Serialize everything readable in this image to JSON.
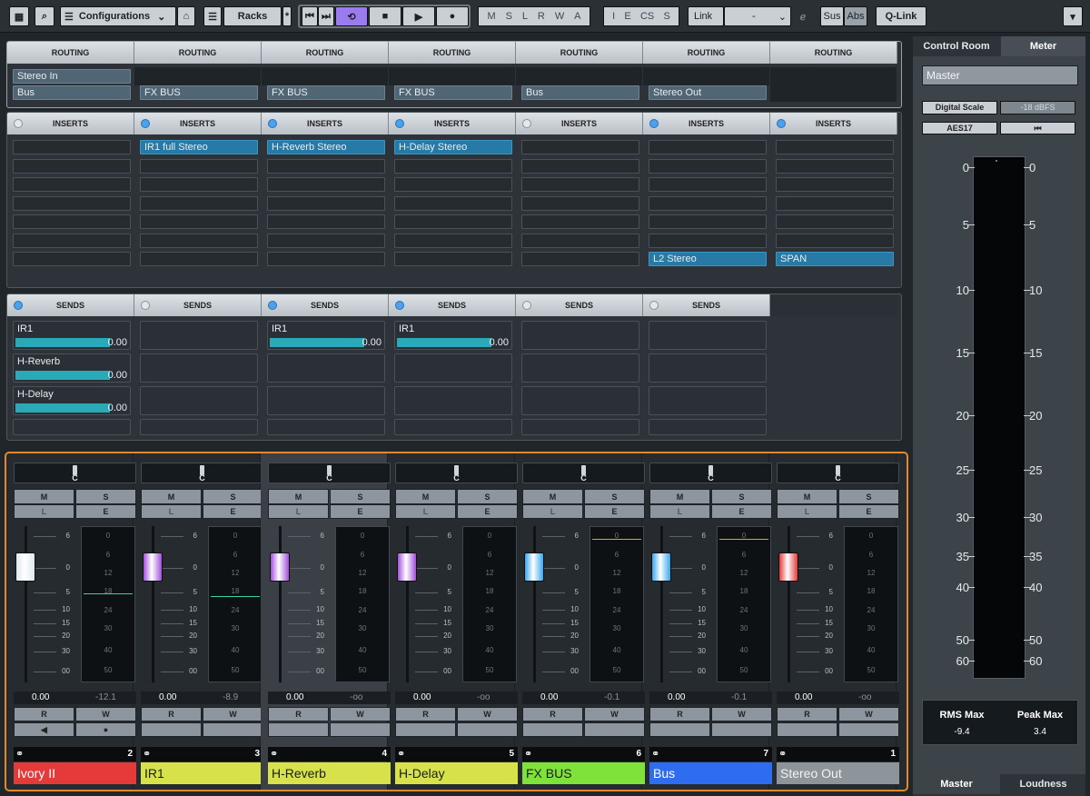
{
  "toolbar": {
    "configurations": "Configurations",
    "racks": "Racks",
    "letters1": [
      "M",
      "S",
      "L",
      "R",
      "W",
      "A"
    ],
    "letters2": [
      "I",
      "E",
      "CS",
      "S"
    ],
    "link": "Link",
    "link_value": "-",
    "sus": "Sus",
    "abs": "Abs",
    "qlink": "Q-Link"
  },
  "routing": {
    "header": "ROUTING",
    "row1": [
      "Stereo In",
      "",
      "",
      "",
      "",
      "",
      ""
    ],
    "row2": [
      "Bus",
      "FX BUS",
      "FX BUS",
      "FX BUS",
      "Bus",
      "Stereo Out",
      ""
    ]
  },
  "inserts": {
    "header": "INSERTS",
    "active": [
      false,
      true,
      true,
      true,
      false,
      true,
      true
    ],
    "slots": [
      [
        "",
        "",
        "",
        "",
        "",
        "",
        ""
      ],
      [
        "IR1 full Stereo",
        "",
        "",
        "",
        "",
        "",
        ""
      ],
      [
        "H-Reverb Stereo",
        "",
        "",
        "",
        "",
        "",
        ""
      ],
      [
        "H-Delay Stereo",
        "",
        "",
        "",
        "",
        "",
        ""
      ],
      [
        "",
        "",
        "",
        "",
        "",
        "",
        ""
      ],
      [
        "",
        "",
        "",
        "",
        "",
        "",
        "L2 Stereo"
      ],
      [
        "",
        "",
        "",
        "",
        "",
        "",
        "SPAN"
      ]
    ]
  },
  "sends": {
    "header": "SENDS",
    "active": [
      true,
      false,
      true,
      true,
      false,
      false,
      null
    ],
    "items": [
      [
        {
          "name": "IR1",
          "value": "0.00"
        },
        {
          "name": "H-Reverb",
          "value": "0.00"
        },
        {
          "name": "H-Delay",
          "value": "0.00"
        }
      ],
      [],
      [
        {
          "name": "IR1",
          "value": "0.00"
        }
      ],
      [
        {
          "name": "IR1",
          "value": "0.00"
        }
      ],
      [],
      [],
      []
    ]
  },
  "mixer": {
    "pan_label": "C",
    "mute": "M",
    "solo": "S",
    "listen": "L",
    "edit": "E",
    "read": "R",
    "write": "W",
    "fader_scale": [
      "6",
      "0",
      "5",
      "10",
      "15",
      "20",
      "30",
      "00"
    ],
    "meter_scale": [
      "0",
      "6",
      "12",
      "18",
      "24",
      "30",
      "40",
      "50"
    ],
    "channels": [
      {
        "name": "Ivory II",
        "number": "2",
        "volume": "0.00",
        "peak": "-12.1",
        "color": "#e53a3a",
        "cap": "#dfe8ef",
        "level": 0.62
      },
      {
        "name": "IR1",
        "number": "3",
        "volume": "0.00",
        "peak": "-8.9",
        "color": "#d7e24a",
        "cap": "#a24fd9",
        "level": 0.6
      },
      {
        "name": "H-Reverb",
        "number": "4",
        "volume": "0.00",
        "peak": "-oo",
        "color": "#d7e24a",
        "cap": "#a24fd9",
        "level": 0
      },
      {
        "name": "H-Delay",
        "number": "5",
        "volume": "0.00",
        "peak": "-oo",
        "color": "#d7e24a",
        "cap": "#a24fd9",
        "level": 0
      },
      {
        "name": "FX BUS",
        "number": "6",
        "volume": "0.00",
        "peak": "-0.1",
        "color": "#7ee23a",
        "cap": "#3aa6ec",
        "level": 0.97
      },
      {
        "name": "Bus",
        "number": "7",
        "volume": "0.00",
        "peak": "-0.1",
        "color": "#2e6cf0",
        "cap": "#3aa6ec",
        "level": 0.97
      },
      {
        "name": "Stereo Out",
        "number": "1",
        "volume": "0.00",
        "peak": "-oo",
        "color": "#8d949a",
        "cap": "#e53a3a",
        "level": 0
      }
    ]
  },
  "right": {
    "tab_control_room": "Control Room",
    "tab_meter": "Meter",
    "master": "Master",
    "digital_scale": "Digital Scale",
    "dbfs": "-18 dBFS",
    "aes": "AES17",
    "scale_left": [
      "0",
      "5",
      "10",
      "15",
      "20",
      "25",
      "30",
      "35",
      "40",
      "50",
      "60"
    ],
    "scale_right": [
      "0",
      "5",
      "10",
      "15",
      "20",
      "25",
      "30",
      "35",
      "40",
      "50",
      "60"
    ],
    "rms_label": "RMS Max",
    "rms_value": "-9.4",
    "peak_label": "Peak Max",
    "peak_value": "3.4",
    "tab_master": "Master",
    "tab_loudness": "Loudness"
  }
}
